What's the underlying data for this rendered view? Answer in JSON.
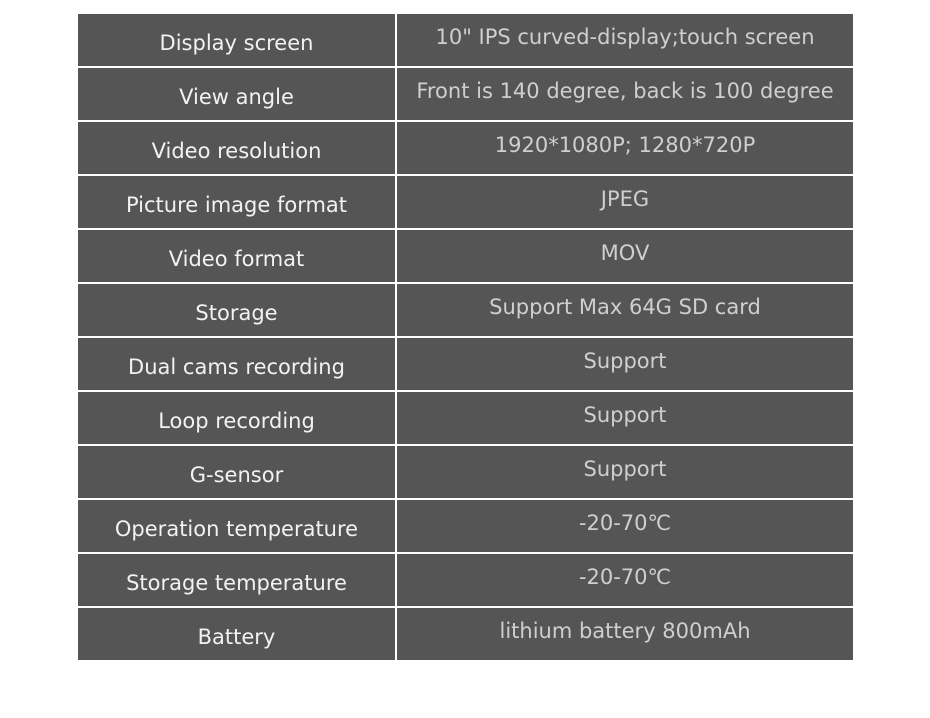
{
  "specs": [
    {
      "label": "Display screen",
      "value": "10\" IPS curved-display;touch screen"
    },
    {
      "label": "View angle",
      "value": "Front is 140 degree, back is 100 degree"
    },
    {
      "label": "Video resolution",
      "value": "1920*1080P; 1280*720P"
    },
    {
      "label": "Picture image format",
      "value": "JPEG"
    },
    {
      "label": "Video format",
      "value": "MOV"
    },
    {
      "label": "Storage",
      "value": "Support Max 64G SD card"
    },
    {
      "label": "Dual cams recording",
      "value": "Support"
    },
    {
      "label": "Loop recording",
      "value": "Support"
    },
    {
      "label": "G-sensor",
      "value": "Support"
    },
    {
      "label": "Operation temperature",
      "value": "-20-70℃"
    },
    {
      "label": "Storage temperature",
      "value": "-20-70℃"
    },
    {
      "label": "Battery",
      "value": "lithium battery 800mAh"
    }
  ]
}
